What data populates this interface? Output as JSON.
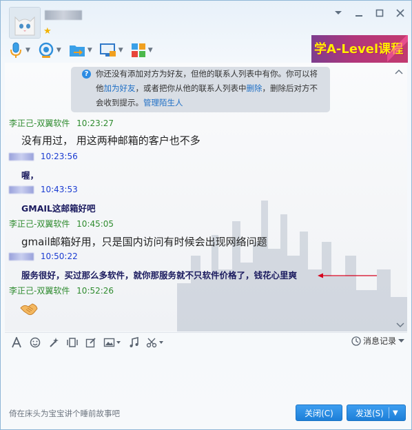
{
  "header": {
    "icons": {
      "avatar": "cat-avatar-icon",
      "star": "vip-star-icon",
      "dropdown": "chevron-down-icon",
      "minimize": "minimize-icon",
      "maximize": "maximize-icon",
      "close": "close-icon"
    }
  },
  "toolbar": {
    "items": [
      {
        "name": "voice-call-button",
        "icon": "microphone-icon"
      },
      {
        "name": "video-call-button",
        "icon": "camera-icon"
      },
      {
        "name": "send-file-button",
        "icon": "folder-arrow-icon"
      },
      {
        "name": "remote-desktop-button",
        "icon": "monitor-icon"
      },
      {
        "name": "apps-button",
        "icon": "apps-grid-icon"
      }
    ]
  },
  "banner": {
    "text": "学A-Level课程"
  },
  "notice": {
    "line1": "你还没有添加对方为好友，但他的联系人列表中有你。你可以将",
    "line2_pre": "他",
    "add_friend_link": "加为好友",
    "line2_mid": "，或者把你从他的联系人列表中",
    "delete_link": "删除",
    "line2_post": "，删除后对方不",
    "line3": "会收到提示。",
    "manage_link": "管理陌生人"
  },
  "messages": [
    {
      "sender": "李正己-双翼软件",
      "time": "10:23:27",
      "text": "没有用过， 用这两种邮箱的客户也不多"
    },
    {
      "sender": "",
      "time": "10:23:56",
      "text": "喔，"
    },
    {
      "sender": "",
      "time": "10:43:53",
      "text": "GMAIL这邮箱好吧"
    },
    {
      "sender": "李正己-双翼软件",
      "time": "10:45:05",
      "text": "gmail邮箱好用，只是国内访问有时候会出现网络问题"
    },
    {
      "sender": "",
      "time": "10:50:22",
      "text": "服务很好，买过那么多软件，就你那服务就不只软件价格了，钱花心里爽"
    },
    {
      "sender": "李正己-双翼软件",
      "time": "10:52:26",
      "text": ""
    }
  ],
  "emoji_icon": "handshake-icon",
  "input_toolbar": {
    "icons": [
      "font-icon",
      "smiley-icon",
      "magic-wand-icon",
      "screen-vibrate-icon",
      "edit-icon",
      "image-icon",
      "music-icon",
      "scissors-icon"
    ],
    "history_label": "消息记录"
  },
  "footer": {
    "status": "倚在床头为宝宝讲个睡前故事吧",
    "close_btn": "关闭(C)",
    "send_btn": "发送(S)"
  },
  "colors": {
    "sender_green": "#2e8b2e",
    "time_blue": "#1a3bd1",
    "link_blue": "#1f6fc5",
    "button_blue": "#1d7fd8",
    "annotation_red": "#d6001c"
  }
}
